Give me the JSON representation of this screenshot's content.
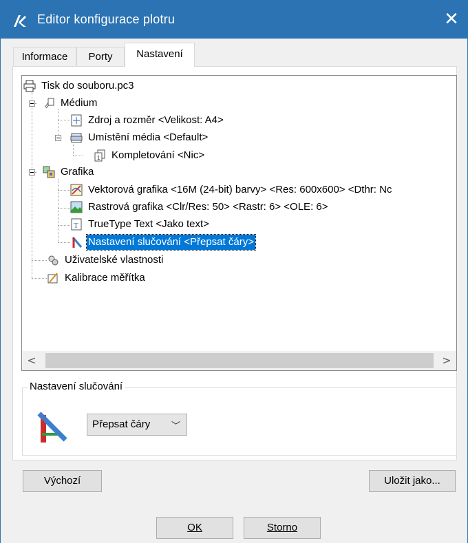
{
  "window": {
    "title": "Editor konfigurace plotru",
    "close_symbol": "✕"
  },
  "tabs": [
    {
      "label": "Informace",
      "active": false
    },
    {
      "label": "Porty",
      "active": false
    },
    {
      "label": "Nastavení",
      "active": true
    }
  ],
  "tree": {
    "root": {
      "label": "Tisk do souboru.pc3",
      "icon": "printer-icon"
    },
    "items": [
      {
        "label": "Médium",
        "icon": "media-clip-icon",
        "expanded": true
      },
      {
        "label": "Zdroj a rozměr <Velikost: A4>",
        "icon": "paper-size-icon"
      },
      {
        "label": "Umístění média <Default>",
        "icon": "media-tray-icon",
        "expanded": true
      },
      {
        "label": "Kompletování <Nic>",
        "icon": "collate-icon"
      },
      {
        "label": "Grafika",
        "icon": "graphics-icon",
        "expanded": true
      },
      {
        "label": "Vektorová grafika <16M (24-bit) barvy> <Res: 600x600> <Dthr: Nc",
        "icon": "vector-graphics-icon"
      },
      {
        "label": "Rastrová grafika <Clr/Res: 50> <Rastr: 6> <OLE: 6>",
        "icon": "raster-graphics-icon"
      },
      {
        "label": "TrueType Text <Jako text>",
        "icon": "truetype-icon"
      },
      {
        "label": "Nastavení slučování <Přepsat čáry>",
        "icon": "merge-control-icon",
        "selected": true
      },
      {
        "label": "Uživatelské vlastnosti",
        "icon": "custom-properties-icon"
      },
      {
        "label": "Kalibrace měřítka",
        "icon": "calibration-icon"
      }
    ],
    "scroll_left": "<",
    "scroll_right": ">"
  },
  "merge_group": {
    "title": "Nastavení slučování",
    "select_value": "Přepsat čáry",
    "chevron": "﹀"
  },
  "buttons": {
    "defaults": "Výchozí",
    "save_as": "Uložit jako...",
    "ok": "OK",
    "cancel": "Storno"
  },
  "colors": {
    "titlebar": "#2b73b2",
    "selection": "#0078d7"
  }
}
